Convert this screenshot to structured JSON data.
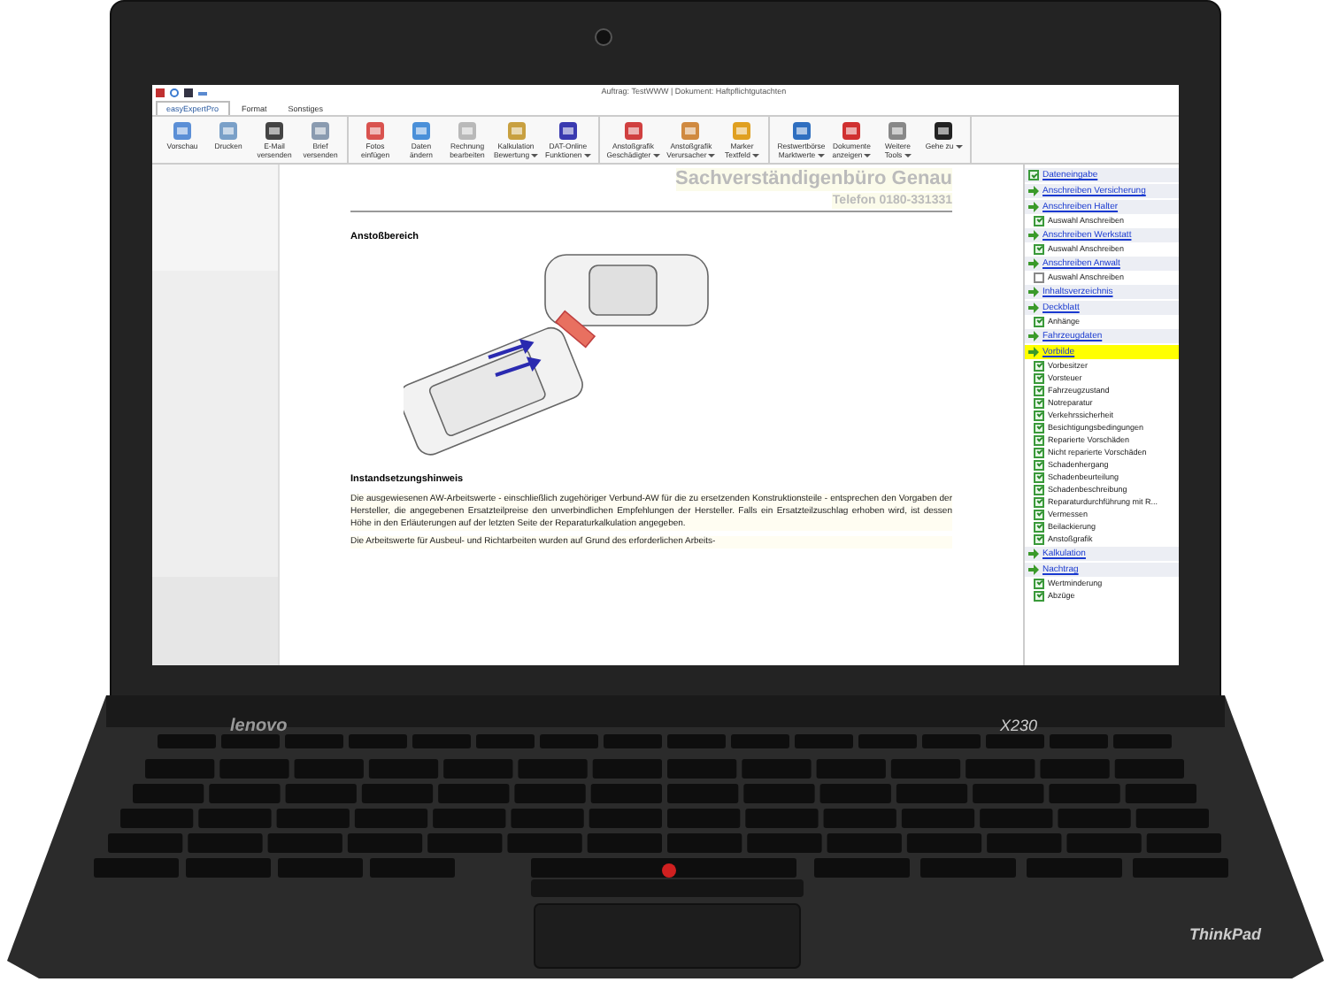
{
  "window": {
    "title": "Auftrag: TestWWW | Dokument: Haftpflichtgutachten"
  },
  "tabs": [
    {
      "label": "easyExpertPro",
      "selected": true
    },
    {
      "label": "Format",
      "selected": false
    },
    {
      "label": "Sonstiges",
      "selected": false
    }
  ],
  "ribbon_groups": [
    {
      "buttons": [
        {
          "lines": [
            "Vorschau"
          ],
          "dropdown": false
        },
        {
          "lines": [
            "Drucken"
          ],
          "dropdown": false
        },
        {
          "lines": [
            "E-Mail",
            "versenden"
          ],
          "dropdown": false
        },
        {
          "lines": [
            "Brief",
            "versenden"
          ],
          "dropdown": false
        }
      ]
    },
    {
      "buttons": [
        {
          "lines": [
            "Fotos",
            "einfügen"
          ],
          "dropdown": false
        },
        {
          "lines": [
            "Daten",
            "ändern"
          ],
          "dropdown": false
        },
        {
          "lines": [
            "Rechnung",
            "bearbeiten"
          ],
          "dropdown": false
        },
        {
          "lines": [
            "Kalkulation",
            "Bewertung"
          ],
          "dropdown": true
        },
        {
          "lines": [
            "DAT-Online",
            "Funktionen"
          ],
          "dropdown": true
        }
      ]
    },
    {
      "buttons": [
        {
          "lines": [
            "Anstoßgrafik",
            "Geschädigter"
          ],
          "dropdown": true
        },
        {
          "lines": [
            "Anstoßgrafik",
            "Verursacher"
          ],
          "dropdown": true
        },
        {
          "lines": [
            "Marker",
            "Textfeld"
          ],
          "dropdown": true
        }
      ]
    },
    {
      "buttons": [
        {
          "lines": [
            "Restwertbörse",
            "Marktwerte"
          ],
          "dropdown": true
        },
        {
          "lines": [
            "Dokumente",
            "anzeigen"
          ],
          "dropdown": true
        },
        {
          "lines": [
            "Weitere",
            "Tools"
          ],
          "dropdown": true
        },
        {
          "lines": [
            "Gehe zu"
          ],
          "dropdown": true
        }
      ]
    }
  ],
  "document": {
    "letterhead": "Sachverständigenbüro Genau",
    "phone": "Telefon 0180-331331",
    "section_1": "Anstoßbereich",
    "section_2": "Instandsetzungshinweis",
    "paragraphs": [
      "Die ausgewiesenen AW-Arbeitswerte - einschließlich zugehöriger Verbund-AW für die zu ersetzenden Konstruktionsteile - entsprechen den Vorgaben der Hersteller, die angegebenen Ersatzteilpreise den unverbindlichen Empfehlungen der Hersteller. Falls ein Ersatzteilzuschlag erhoben wird, ist dessen Höhe in den Erläuterungen auf der letzten Seite der Reparaturkalkulation angegeben.",
      "Die Arbeitswerte für Ausbeul- und Richtarbeiten wurden auf Grund des erforderlichen Arbeits-"
    ]
  },
  "outline": {
    "items": [
      {
        "kind": "check-link",
        "label": "Dateneingabe",
        "checked": true,
        "selected": false
      },
      {
        "kind": "link",
        "label": "Anschreiben Versicherung",
        "selected": false
      },
      {
        "kind": "link",
        "label": "Anschreiben Halter",
        "selected": false,
        "children": [
          {
            "label": "Auswahl Anschreiben",
            "checked": true
          }
        ]
      },
      {
        "kind": "link",
        "label": "Anschreiben Werkstatt",
        "selected": false,
        "children": [
          {
            "label": "Auswahl Anschreiben",
            "checked": true
          }
        ]
      },
      {
        "kind": "link",
        "label": "Anschreiben Anwalt",
        "selected": false,
        "children": [
          {
            "label": "Auswahl Anschreiben",
            "checked": false
          }
        ]
      },
      {
        "kind": "link",
        "label": "Inhaltsverzeichnis",
        "selected": false
      },
      {
        "kind": "link",
        "label": "Deckblatt",
        "selected": false,
        "children": [
          {
            "label": "Anhänge",
            "checked": true
          }
        ]
      },
      {
        "kind": "link",
        "label": "Fahrzeugdaten",
        "selected": false
      },
      {
        "kind": "link",
        "label": "Vorbilde",
        "selected": true,
        "children": [
          {
            "label": "Vorbesitzer",
            "checked": true
          },
          {
            "label": "Vorsteuer",
            "checked": true
          },
          {
            "label": "Fahrzeugzustand",
            "checked": true
          },
          {
            "label": "Notreparatur",
            "checked": true
          },
          {
            "label": "Verkehrssicherheit",
            "checked": true
          },
          {
            "label": "Besichtigungsbedingungen",
            "checked": true
          },
          {
            "label": "Reparierte Vorschäden",
            "checked": true
          },
          {
            "label": "Nicht reparierte Vorschäden",
            "checked": true
          },
          {
            "label": "Schadenhergang",
            "checked": true
          },
          {
            "label": "Schadenbeurteilung",
            "checked": true
          },
          {
            "label": "Schadenbeschreibung",
            "checked": true
          },
          {
            "label": "Reparaturdurchführung mit R...",
            "checked": true
          },
          {
            "label": "Vermessen",
            "checked": true
          },
          {
            "label": "Beilackierung",
            "checked": true
          },
          {
            "label": "Anstoßgrafik",
            "checked": true
          }
        ]
      },
      {
        "kind": "link",
        "label": "Kalkulation",
        "selected": false
      },
      {
        "kind": "link",
        "label": "Nachtrag",
        "selected": false,
        "children": [
          {
            "label": "Wertminderung",
            "checked": true
          },
          {
            "label": "Abzüge",
            "checked": true
          }
        ]
      }
    ]
  },
  "branding": {
    "lid_logo": "lenovo",
    "model": "X230",
    "palmrest_logo": "ThinkPad"
  }
}
